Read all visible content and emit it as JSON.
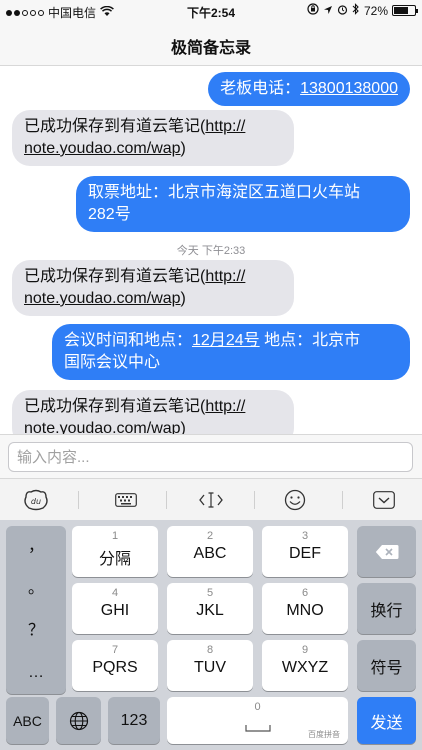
{
  "status_bar": {
    "carrier": "中国电信",
    "time": "下午2:54",
    "battery": "72%",
    "battery_level": 0.72
  },
  "nav": {
    "title": "极简备忘录"
  },
  "messages": [
    {
      "dir": "out",
      "label": "老板电话：",
      "link": "13800138000"
    },
    {
      "dir": "in",
      "text1": "已成功保存到有道云笔记(",
      "link1": "http://",
      "link2": "note.youdao.com/wap",
      "text2": ")"
    },
    {
      "dir": "out",
      "text1": "取票地址：北京市海淀区五道口火车站",
      "text2": "282号"
    },
    {
      "dir": "in",
      "text1": "已成功保存到有道云笔记(",
      "link1": "http://",
      "link2": "note.youdao.com/wap",
      "text2": ")"
    },
    {
      "dir": "out",
      "text1": "会议时间和地点：",
      "link": "12月24号",
      "text2": " 地点：北京市",
      "text3": "国际会议中心"
    },
    {
      "dir": "in",
      "text1": "已成功保存到有道云笔记(",
      "link1": "http://",
      "link2": "note.youdao.com/wap",
      "text2": ")"
    }
  ],
  "timestamp": "今天 下午2:33",
  "input": {
    "placeholder": "输入内容..."
  },
  "toolbar": {
    "icons": [
      "du-logo-icon",
      "keyboard-icon",
      "cursor-icon",
      "smiley-icon",
      "collapse-keyboard-icon"
    ],
    "cursor_label": "‹I›"
  },
  "keyboard": {
    "punctuation": [
      "，",
      "。",
      "？",
      "…"
    ],
    "keys": [
      {
        "num": "1",
        "label": "分隔"
      },
      {
        "num": "2",
        "label": "ABC"
      },
      {
        "num": "3",
        "label": "DEF"
      },
      {
        "num": "4",
        "label": "GHI"
      },
      {
        "num": "5",
        "label": "JKL"
      },
      {
        "num": "6",
        "label": "MNO"
      },
      {
        "num": "7",
        "label": "PQRS"
      },
      {
        "num": "8",
        "label": "TUV"
      },
      {
        "num": "9",
        "label": "WXYZ"
      }
    ],
    "backspace_icon": "backspace-icon",
    "newline": "换行",
    "symbol": "符号",
    "abc": "ABC",
    "globe_icon": "globe-icon",
    "num123": "123",
    "zero": "0",
    "space_brand": "百度拼音",
    "send": "发送"
  }
}
